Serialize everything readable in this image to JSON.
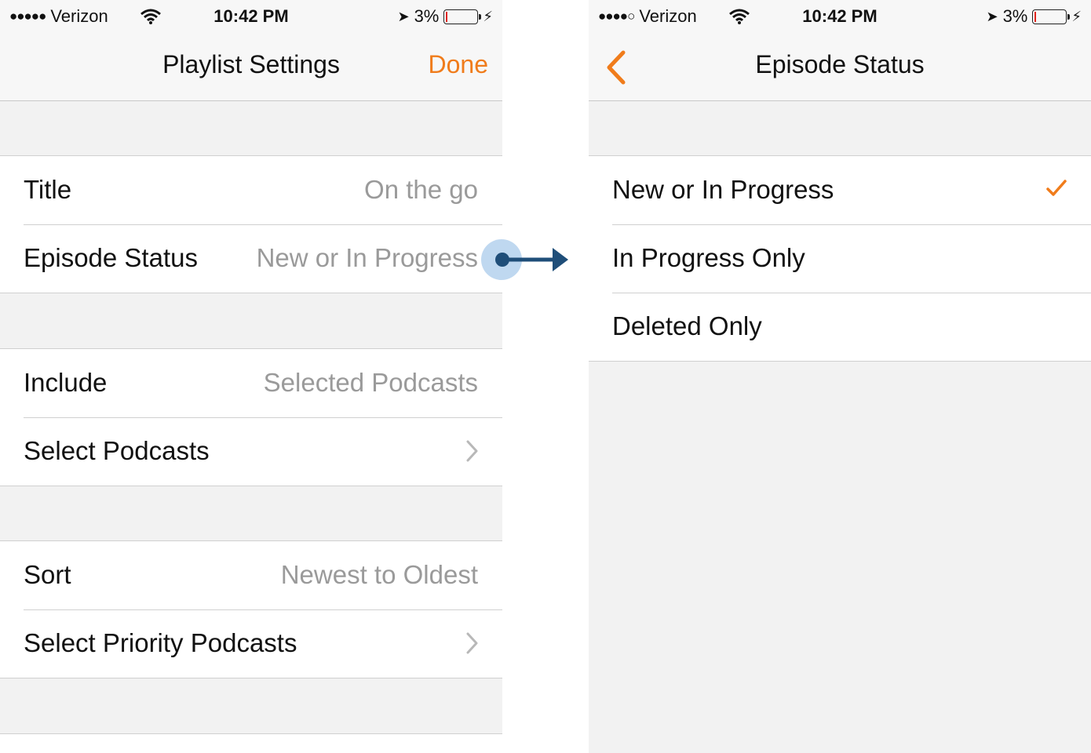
{
  "status_bar_left": {
    "signal": "●●●●●",
    "carrier": "Verizon",
    "time": "10:42 PM",
    "battery": "3%"
  },
  "status_bar_right": {
    "signal": "●●●●○",
    "carrier": "Verizon",
    "time": "10:42 PM",
    "battery": "3%"
  },
  "playlist_settings": {
    "title": "Playlist Settings",
    "done_label": "Done",
    "rows": [
      {
        "label": "Title",
        "value": "On the go"
      },
      {
        "label": "Episode Status",
        "value": "New or In Progress"
      },
      {
        "label": "Include",
        "value": "Selected Podcasts"
      },
      {
        "label": "Select Podcasts",
        "value": ""
      },
      {
        "label": "Sort",
        "value": "Newest to Oldest"
      },
      {
        "label": "Select Priority Podcasts",
        "value": ""
      }
    ]
  },
  "episode_status": {
    "title": "Episode Status",
    "options": [
      {
        "label": "New or In Progress",
        "selected": true
      },
      {
        "label": "In Progress Only",
        "selected": false
      },
      {
        "label": "Deleted Only",
        "selected": false
      }
    ]
  },
  "colors": {
    "accent": "#f07c1b",
    "annotation_arrow": "#1f4e79",
    "touch_halo": "#a9cbeb"
  }
}
